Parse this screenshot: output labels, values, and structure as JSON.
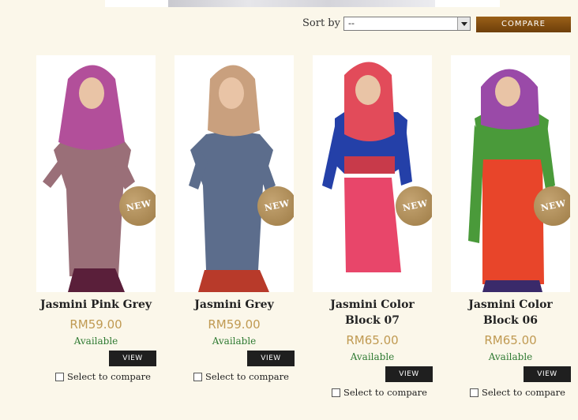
{
  "sort": {
    "label": "Sort by",
    "selected": "--"
  },
  "compare_button": "COMPARE",
  "products": [
    {
      "name": "Jasmini Pink Grey",
      "price": "RM59.00",
      "availability": "Available",
      "badge": "NEW",
      "view": "VIEW",
      "compare": "Select to compare",
      "colors": {
        "hijab": "#b24f9a",
        "dress": "#9a6f78",
        "skirt": "#5a1f3a"
      }
    },
    {
      "name": "Jasmini Grey",
      "price": "RM59.00",
      "availability": "Available",
      "badge": "NEW",
      "view": "VIEW",
      "compare": "Select to compare",
      "colors": {
        "hijab": "#c9a07e",
        "dress": "#5c6d8c",
        "skirt": "#b83a2a"
      }
    },
    {
      "name": "Jasmini Color Block 07",
      "price": "RM65.00",
      "availability": "Available",
      "badge": "NEW",
      "view": "VIEW",
      "compare": "Select to compare",
      "colors": {
        "hijab": "#e24b5a",
        "dress": "#e8466a",
        "top": "#2440a8"
      }
    },
    {
      "name": "Jasmini Color Block 06",
      "price": "RM65.00",
      "availability": "Available",
      "badge": "NEW",
      "view": "VIEW",
      "compare": "Select to compare",
      "colors": {
        "hijab": "#9a4aa8",
        "dress": "#e8452a",
        "top": "#4a9a3a"
      }
    }
  ]
}
